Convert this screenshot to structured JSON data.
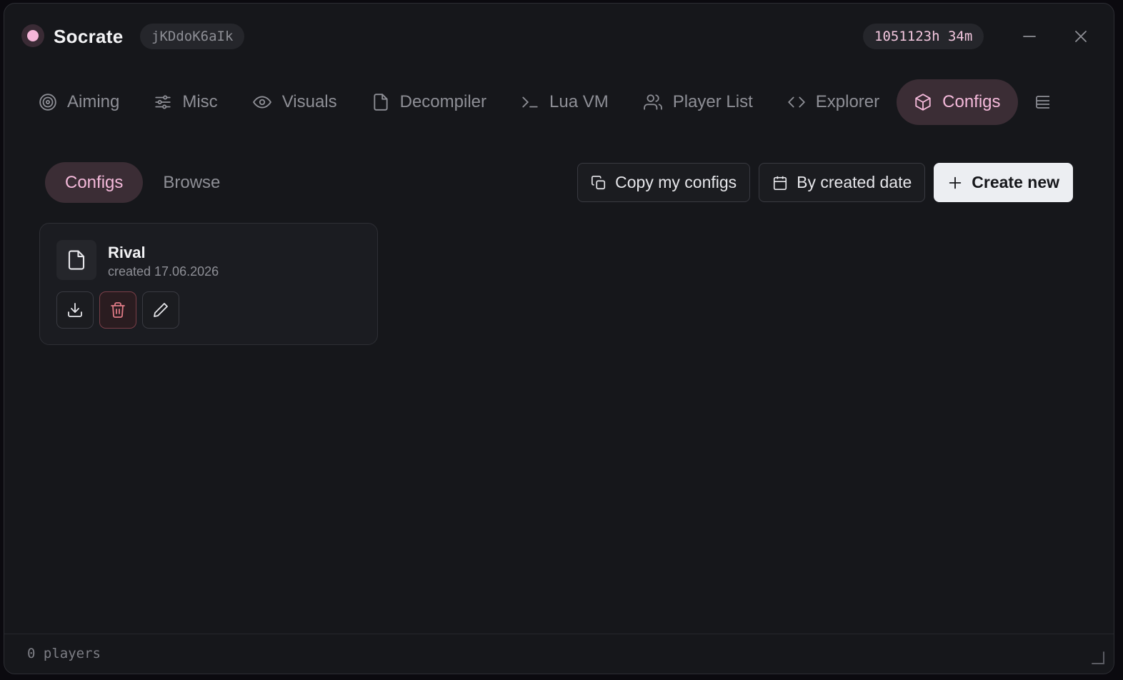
{
  "window": {
    "title": "Socrate",
    "session_id": "jKDdoK6aIk",
    "uptime": "1051123h 34m"
  },
  "tabs": [
    {
      "label": "Aiming",
      "icon": "target-icon",
      "active": false
    },
    {
      "label": "Misc",
      "icon": "sliders-icon",
      "active": false
    },
    {
      "label": "Visuals",
      "icon": "eye-icon",
      "active": false
    },
    {
      "label": "Decompiler",
      "icon": "file-icon",
      "active": false
    },
    {
      "label": "Lua VM",
      "icon": "terminal-icon",
      "active": false
    },
    {
      "label": "Player List",
      "icon": "users-icon",
      "active": false
    },
    {
      "label": "Explorer",
      "icon": "code-icon",
      "active": false
    },
    {
      "label": "Configs",
      "icon": "box-icon",
      "active": true
    }
  ],
  "subtabs": [
    {
      "label": "Configs",
      "active": true
    },
    {
      "label": "Browse",
      "active": false
    }
  ],
  "actions": {
    "copy_label": "Copy my configs",
    "sort_label": "By created date",
    "create_label": "Create new"
  },
  "configs": [
    {
      "name": "Rival",
      "meta": "created 17.06.2026"
    }
  ],
  "footer": {
    "status": "0 players"
  },
  "colors": {
    "accent": "#f4b9da",
    "accent_bg": "#3b2d35",
    "background": "#16171b",
    "danger": "#e07b86"
  }
}
